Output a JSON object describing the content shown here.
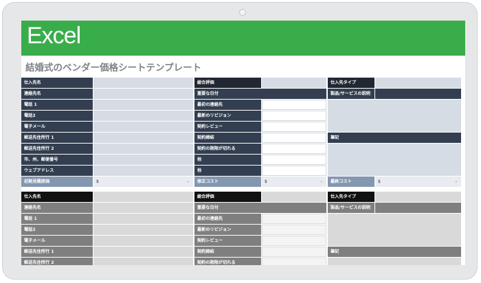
{
  "banner": {
    "title": "Excel",
    "color": "#3aad4b"
  },
  "doc_title": "結婚式のベンダー価格シートテンプレート",
  "colors": {
    "label_dark": "#333f50",
    "value_light": "#d6dce4",
    "label_gray": "#7f7f7f",
    "value_gray": "#d9d9d9"
  },
  "sheet1": {
    "col1": [
      "仕入先名",
      "連絡先名",
      "電話 1",
      "電話2",
      "電子メール",
      "郵送先住所行 1",
      "郵送先住所行 2",
      "市、州、郵便番号",
      "ウェブアドレス"
    ],
    "col2": [
      "総合評価",
      "重要な日付",
      "最初の連絡先",
      "最新のリビジョン",
      "契約レビュー",
      "契約締結",
      "契約の期限が切れる",
      "他",
      "他"
    ],
    "col3": [
      "仕入先タイプ",
      "製品/サービスの説明",
      "筆記"
    ],
    "totals": {
      "initial_label": "初期見積原価",
      "change_label": "修正コスト",
      "final_label": "最終コスト",
      "currency": "$",
      "empty": "-"
    }
  },
  "sheet2": {
    "col1": [
      "仕入先名",
      "連絡先名",
      "電話 1",
      "電話2",
      "電子メール",
      "郵送先住所行 1",
      "郵送先住所行 2"
    ],
    "col2": [
      "総合評価",
      "重要な日付",
      "最初の連絡先",
      "最新のリビジョン",
      "契約レビュー",
      "契約締結",
      "契約の期限が切れる"
    ],
    "col3": [
      "仕入先タイプ",
      "製品/サービスの説明",
      "筆記"
    ]
  }
}
